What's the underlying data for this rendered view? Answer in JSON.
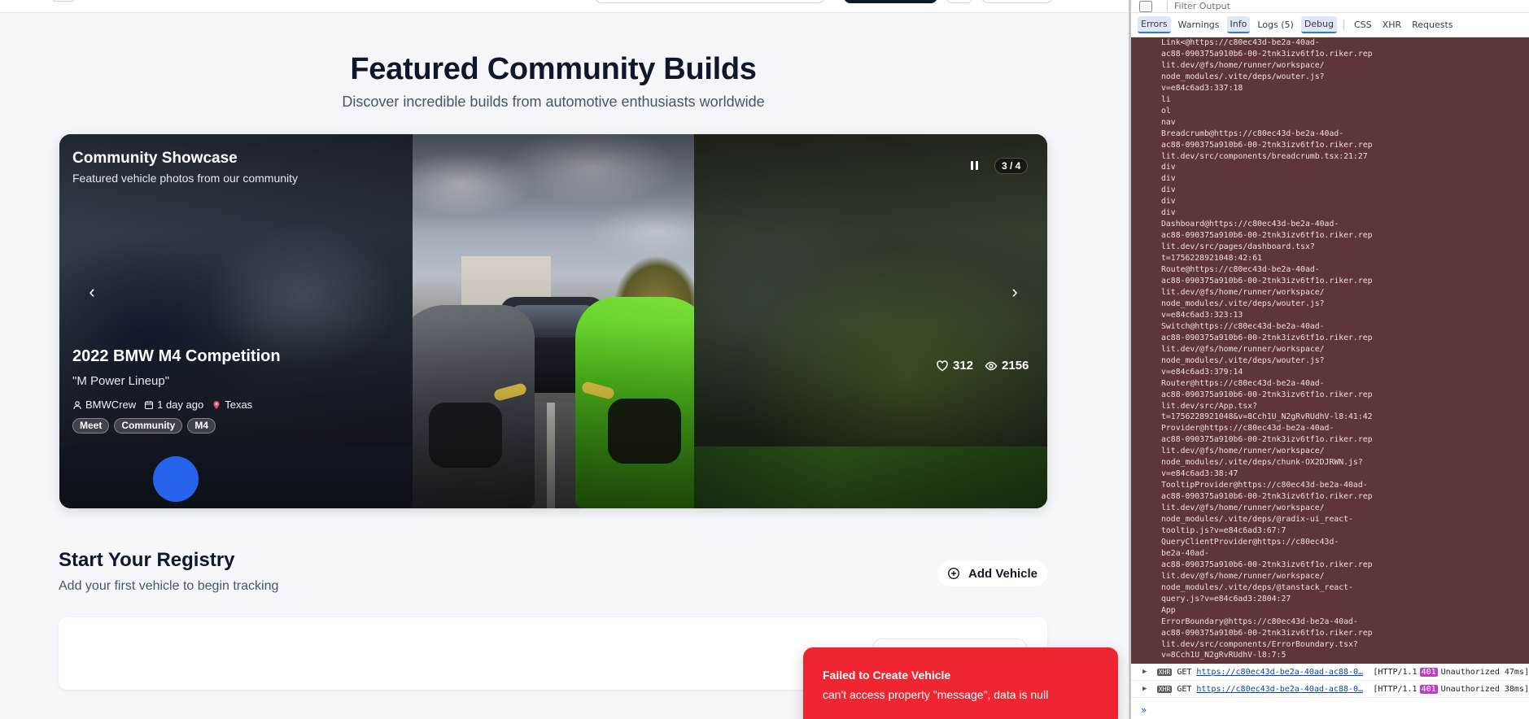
{
  "featured": {
    "title": "Featured Community Builds",
    "subtitle": "Discover incredible builds from automotive enthusiasts worldwide"
  },
  "carousel": {
    "title": "Community Showcase",
    "subtitle": "Featured vehicle photos from our community",
    "counter": "3 / 4",
    "prev_glyph": "‹",
    "next_glyph": "›",
    "vehicle_title": "2022 BMW M4 Competition",
    "vehicle_nickname": "\"M Power Lineup\"",
    "owner": "BMWCrew",
    "posted": "1 day ago",
    "location": "Texas",
    "tags": [
      "Meet",
      "Community",
      "M4"
    ],
    "likes": "312",
    "views": "2156",
    "active_slide": 3,
    "total_slides": 4
  },
  "registry": {
    "title": "Start Your Registry",
    "subtitle": "Add your first vehicle to begin tracking",
    "add_label": "Add Vehicle"
  },
  "toast": {
    "title": "Failed to Create Vehicle",
    "message": "can't access property \"message\", data is null",
    "color": "#ef2532"
  },
  "devtools": {
    "filter_placeholder": "Filter Output",
    "tabs": [
      "Errors",
      "Warnings",
      "Info",
      "Logs (5)",
      "Debug",
      "CSS",
      "XHR",
      "Requests"
    ],
    "active_tabs": [
      "Errors",
      "Info",
      "Debug"
    ],
    "log_lines": [
      "Link<@https://c80ec43d-be2a-40ad-",
      "ac88-090375a910b6-00-2tnk3izv6tf1o.riker.rep",
      "lit.dev/@fs/home/runner/workspace/",
      "node_modules/.vite/deps/wouter.js?",
      "v=e84c6ad3:337:18",
      "li",
      "ol",
      "nav",
      "Breadcrumb@https://c80ec43d-be2a-40ad-",
      "ac88-090375a910b6-00-2tnk3izv6tf1o.riker.rep",
      "lit.dev/src/components/breadcrumb.tsx:21:27",
      "div",
      "div",
      "div",
      "div",
      "div",
      "Dashboard@https://c80ec43d-be2a-40ad-",
      "ac88-090375a910b6-00-2tnk3izv6tf1o.riker.rep",
      "lit.dev/src/pages/dashboard.tsx?",
      "t=1756228921048:42:61",
      "Route@https://c80ec43d-be2a-40ad-",
      "ac88-090375a910b6-00-2tnk3izv6tf1o.riker.rep",
      "lit.dev/@fs/home/runner/workspace/",
      "node_modules/.vite/deps/wouter.js?",
      "v=e84c6ad3:323:13",
      "Switch@https://c80ec43d-be2a-40ad-",
      "ac88-090375a910b6-00-2tnk3izv6tf1o.riker.rep",
      "lit.dev/@fs/home/runner/workspace/",
      "node_modules/.vite/deps/wouter.js?",
      "v=e84c6ad3:379:14",
      "Router@https://c80ec43d-be2a-40ad-",
      "ac88-090375a910b6-00-2tnk3izv6tf1o.riker.rep",
      "lit.dev/src/App.tsx?",
      "t=1756228921048&v=8Cch1U_N2gRvRUdhV-l8:41:42",
      "Provider@https://c80ec43d-be2a-40ad-",
      "ac88-090375a910b6-00-2tnk3izv6tf1o.riker.rep",
      "lit.dev/@fs/home/runner/workspace/",
      "node_modules/.vite/deps/chunk-OX2DJRWN.js?",
      "v=e84c6ad3:38:47",
      "TooltipProvider@https://c80ec43d-be2a-40ad-",
      "ac88-090375a910b6-00-2tnk3izv6tf1o.riker.rep",
      "lit.dev/@fs/home/runner/workspace/",
      "node_modules/.vite/deps/@radix-ui_react-",
      "tooltip.js?v=e84c6ad3:67:7",
      "QueryClientProvider@https://c80ec43d-",
      "be2a-40ad-",
      "ac88-090375a910b6-00-2tnk3izv6tf1o.riker.rep",
      "lit.dev/@fs/home/runner/workspace/",
      "node_modules/.vite/deps/@tanstack_react-",
      "query.js?v=e84c6ad3:2804:27",
      "App",
      "ErrorBoundary@https://c80ec43d-be2a-40ad-",
      "ac88-090375a910b6-00-2tnk3izv6tf1o.riker.rep",
      "lit.dev/src/components/ErrorBoundary.tsx?",
      "v=8Cch1U_N2gRvRUdhV-l8:7:5"
    ],
    "xhr_requests": [
      {
        "badge": "XHR",
        "method": "GET",
        "url": "https://c80ec43d-be2a-40ad-ac88-0…",
        "protocol": "[HTTP/1.1",
        "code": "401",
        "status": "Unauthorized 47ms]"
      },
      {
        "badge": "XHR",
        "method": "GET",
        "url": "https://c80ec43d-be2a-40ad-ac88-0…",
        "protocol": "[HTTP/1.1",
        "code": "401",
        "status": "Unauthorized 38ms]"
      }
    ],
    "prompt_glyph": "»"
  },
  "colors": {
    "accent_blue": "#2563eb",
    "error_red": "#ef2532",
    "devtools_error_bg": "#5e3638",
    "http_401": "#c13cc4"
  },
  "icons": [
    "user-icon",
    "calendar-icon",
    "map-pin-icon",
    "heart-icon",
    "eye-icon",
    "pause-icon",
    "chevron-left-icon",
    "chevron-right-icon",
    "plus-circle-icon",
    "trash-icon",
    "filter-icon"
  ]
}
